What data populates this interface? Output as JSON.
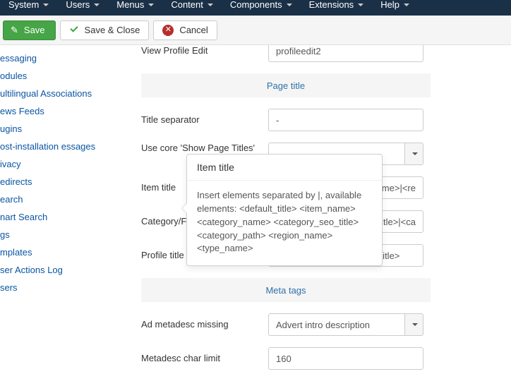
{
  "topnav": [
    "System",
    "Users",
    "Menus",
    "Content",
    "Components",
    "Extensions",
    "Help"
  ],
  "toolbar": {
    "save": "Save",
    "save_close": "Save & Close",
    "cancel": "Cancel"
  },
  "sidebar": [
    "essaging",
    "odules",
    "ultilingual Associations",
    "ews Feeds",
    "ugins",
    "ost-installation essages",
    "ivacy",
    "edirects",
    "earch",
    "nart Search",
    "gs",
    "mplates",
    "ser Actions Log",
    "sers"
  ],
  "sections": {
    "page_title": "Page title",
    "meta_tags": "Meta tags"
  },
  "fields": {
    "view_profile_edit": {
      "label": "View Profile Edit",
      "value": "profileedit2"
    },
    "title_sep": {
      "label": "Title separator",
      "value": "-"
    },
    "use_core": {
      "label": "Use core 'Show Page Titles'"
    },
    "item_title": {
      "label": "Item title",
      "value": "ame>|<re"
    },
    "category_title": {
      "label": "Category/F",
      "value": "title>|<ca"
    },
    "profile_title": {
      "label": "Profile title",
      "value": "<profile_name>|<default_title>"
    },
    "ad_metadesc": {
      "label": "Ad metadesc missing",
      "value": "Advert intro description"
    },
    "metadesc_limit": {
      "label": "Metadesc char limit",
      "value": "160"
    }
  },
  "tooltip": {
    "title": "Item title",
    "body": "Insert elements separated by |, available elements: <default_title> <item_name> <category_name> <category_seo_title> <category_path> <region_name> <type_name>"
  }
}
